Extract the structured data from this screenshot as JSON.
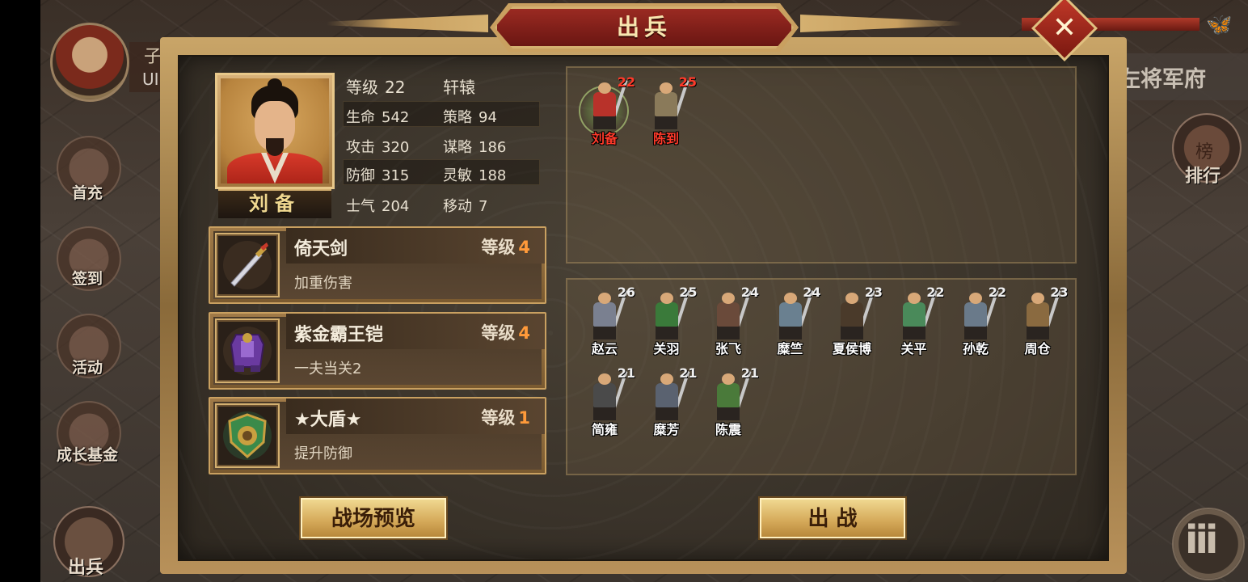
{
  "background": {
    "player_name": "子龙",
    "uid_label": "UID",
    "side_buttons": [
      "首充",
      "签到",
      "活动",
      "成长基金"
    ],
    "bottom_button": "出兵",
    "right_hall": "左将军府",
    "rank_button": "排行",
    "rank_glyph": "榜",
    "menu_icon": "iii"
  },
  "dialog": {
    "title": "出兵",
    "close_icon": "✕"
  },
  "hero": {
    "name": "刘备",
    "stats": {
      "level_label": "等级",
      "level": "22",
      "class": "轩辕",
      "hp_label": "生命",
      "hp": "542",
      "strategy_label": "策略",
      "strategy": "94",
      "attack_label": "攻击",
      "attack": "320",
      "tactics_label": "谋略",
      "tactics": "186",
      "defense_label": "防御",
      "defense": "315",
      "agility_label": "灵敏",
      "agility": "188",
      "morale_label": "士气",
      "morale": "204",
      "move_label": "移动",
      "move": "7"
    }
  },
  "equipment": [
    {
      "name": "倚天剑",
      "level_label": "等级",
      "level": "4",
      "desc": "加重伤害",
      "icon": "sword-icon"
    },
    {
      "name": "紫金霸王铠",
      "level_label": "等级",
      "level": "4",
      "desc": "一夫当关2",
      "icon": "armor-icon"
    },
    {
      "name": "★大盾★",
      "level_label": "等级",
      "level": "1",
      "desc": "提升防御",
      "icon": "shield-icon"
    }
  ],
  "selected_units": [
    {
      "name": "刘备",
      "level": "22",
      "color": "#b8322a"
    },
    {
      "name": "陈到",
      "level": "25",
      "color": "#8a7a5a"
    }
  ],
  "available_units": [
    {
      "name": "赵云",
      "level": "26",
      "color": "#7a8090"
    },
    {
      "name": "关羽",
      "level": "25",
      "color": "#3a7a3a"
    },
    {
      "name": "张飞",
      "level": "24",
      "color": "#6a4a3a"
    },
    {
      "name": "糜竺",
      "level": "24",
      "color": "#6a8090"
    },
    {
      "name": "夏侯博",
      "level": "23",
      "color": "#4a3a2a"
    },
    {
      "name": "关平",
      "level": "22",
      "color": "#4a8a5a"
    },
    {
      "name": "孙乾",
      "level": "22",
      "color": "#6a7a8a"
    },
    {
      "name": "周仓",
      "level": "23",
      "color": "#8a6a40"
    },
    {
      "name": "简雍",
      "level": "21",
      "color": "#4a4a4a"
    },
    {
      "name": "糜芳",
      "level": "21",
      "color": "#5a6270"
    },
    {
      "name": "陈震",
      "level": "21",
      "color": "#4a7a3a"
    }
  ],
  "buttons": {
    "preview": "战场预览",
    "battle": "出 战"
  }
}
